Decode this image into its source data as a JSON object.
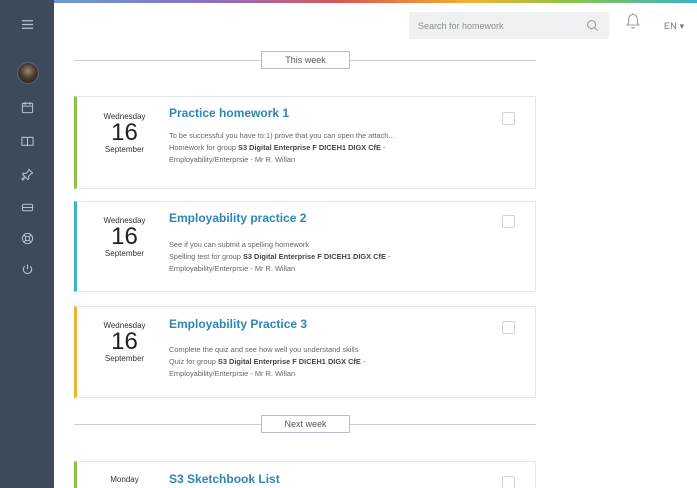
{
  "header": {
    "search_placeholder": "Search for homework",
    "language": "EN ▾"
  },
  "sidebar": {
    "icons": [
      "menu-icon",
      "calendar-icon",
      "book-icon",
      "pin-icon",
      "tray-icon",
      "lifebuoy-icon",
      "power-icon"
    ]
  },
  "sections": {
    "this_week": "This week",
    "next_week": "Next week"
  },
  "cards": [
    {
      "weekday": "Wednesday",
      "day": "16",
      "month": "September",
      "title": "Practice homework 1",
      "description": "To be successful you have to:1) prove that you can open the attach...",
      "group_prefix": "Homework for group ",
      "group_name": "S3 Digital Enterprise F DICEH1 DIGX CfE",
      "group_suffix": " -",
      "teacher": "Employability/Enterprsie - Mr R. Willan",
      "accent": "#8bc34a"
    },
    {
      "weekday": "Wednesday",
      "day": "16",
      "month": "September",
      "title": "Employability practice 2",
      "description": "See if you can submit a spelling homework",
      "group_prefix": "Spelling test for group ",
      "group_name": "S3 Digital Enterprise F DICEH1 DIGX CfE",
      "group_suffix": " -",
      "teacher": "Employability/Enterprsie - Mr R. Willan",
      "accent": "#3bb3c4"
    },
    {
      "weekday": "Wednesday",
      "day": "16",
      "month": "September",
      "title": "Employability Practice 3",
      "description": "Complete the quiz and see how well you understand skills",
      "group_prefix": "Quiz for group ",
      "group_name": "S3 Digital Enterprise F DICEH1 DIGX CfE",
      "group_suffix": " -",
      "teacher": "Employability/Enterprsie - Mr R. Willan",
      "accent": "#f2b233"
    },
    {
      "weekday": "Monday",
      "title": "S3 Sketchbook List",
      "accent": "#8bc34a"
    }
  ]
}
